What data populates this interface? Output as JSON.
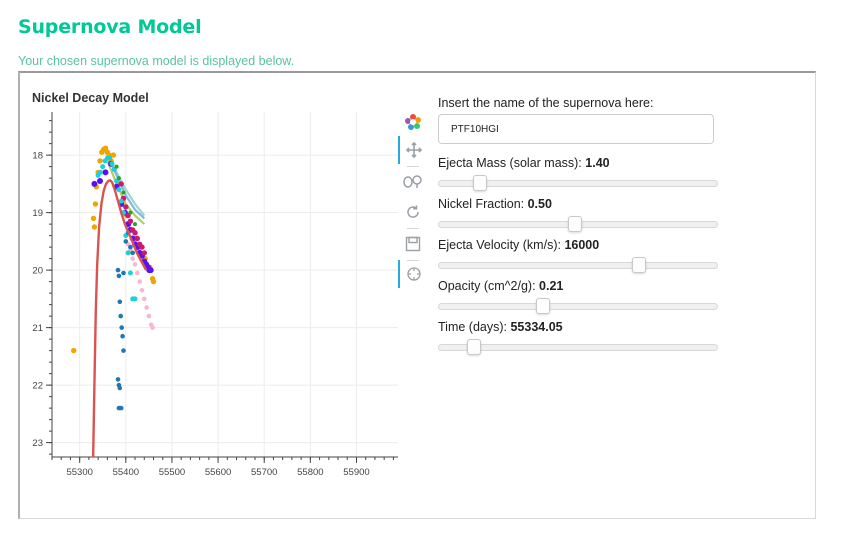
{
  "header": {
    "title": "Supernova Model",
    "subtitle": "Your chosen supernova model is displayed below."
  },
  "toolbar": {
    "tools": [
      {
        "name": "bokeh-logo-icon",
        "active": false
      },
      {
        "name": "pan-icon",
        "active": true
      },
      {
        "name": "box-zoom-icon",
        "active": false
      },
      {
        "name": "reset-icon",
        "active": false
      },
      {
        "name": "save-icon",
        "active": false
      },
      {
        "name": "hover-icon",
        "active": true
      }
    ]
  },
  "controls": {
    "name_label": "Insert the name of the supernova here:",
    "name_value": "PTF10HGI",
    "sliders": [
      {
        "label": "Ejecta Mass (solar mass): ",
        "value_text": "1.40",
        "fraction": 0.13
      },
      {
        "label": "Nickel Fraction: ",
        "value_text": "0.50",
        "fraction": 0.49
      },
      {
        "label": "Ejecta Velocity (km/s): ",
        "value_text": "16000",
        "fraction": 0.73
      },
      {
        "label": "Opacity (cm^2/g): ",
        "value_text": "0.21",
        "fraction": 0.37
      },
      {
        "label": "Time (days): ",
        "value_text": "55334.05",
        "fraction": 0.11
      }
    ]
  },
  "chart_data": {
    "type": "scatter",
    "title": "Nickel Decay Model",
    "xlabel": "",
    "ylabel": "",
    "xlim": [
      55240,
      55990
    ],
    "ylim": [
      23.25,
      17.25
    ],
    "y_inverted": true,
    "grid": true,
    "xticks": [
      55300,
      55400,
      55500,
      55600,
      55700,
      55800,
      55900
    ],
    "yticks": [
      18,
      19,
      20,
      21,
      22,
      23
    ],
    "colors": {
      "orange": "#f0a500",
      "purple": "#5a10f0",
      "magenta": "#cc1a6e",
      "pink": "#f7b6d2",
      "cyan": "#1ecfd6",
      "blue": "#1f77b4",
      "green": "#2ca02c",
      "model": "#d9534f"
    },
    "model_curve": {
      "color": "model",
      "x": [
        55329,
        55332,
        55335,
        55338,
        55342,
        55347,
        55352,
        55357,
        55362,
        55366,
        55370,
        55376,
        55383,
        55390,
        55398,
        55406,
        55414,
        55424,
        55434,
        55444
      ],
      "y": [
        23.3,
        22.0,
        20.7,
        19.9,
        19.25,
        18.85,
        18.62,
        18.5,
        18.45,
        18.44,
        18.47,
        18.6,
        18.8,
        19.0,
        19.2,
        19.35,
        19.5,
        19.7,
        19.85,
        20.0
      ]
    },
    "series": [
      {
        "color": "orange",
        "size": 2.7,
        "points": [
          [
            55287,
            21.4
          ],
          [
            55330,
            19.1
          ],
          [
            55332,
            19.25
          ],
          [
            55334,
            18.85
          ],
          [
            55336,
            18.55
          ],
          [
            55340,
            18.3
          ],
          [
            55344,
            18.1
          ],
          [
            55348,
            17.95
          ],
          [
            55352,
            17.9
          ],
          [
            55356,
            17.88
          ],
          [
            55360,
            17.95
          ],
          [
            55364,
            18.0
          ],
          [
            55368,
            18.1
          ],
          [
            55373,
            18.0
          ],
          [
            55383,
            18.5
          ],
          [
            55392,
            18.8
          ],
          [
            55402,
            19.05
          ],
          [
            55412,
            19.3
          ],
          [
            55422,
            19.45
          ],
          [
            55432,
            19.6
          ],
          [
            55442,
            19.8
          ],
          [
            55452,
            19.95
          ],
          [
            55458,
            20.15
          ],
          [
            55460,
            20.2
          ]
        ]
      },
      {
        "color": "purple",
        "size": 3.0,
        "points": [
          [
            55332,
            18.5
          ],
          [
            55344,
            18.45
          ],
          [
            55356,
            18.3
          ],
          [
            55368,
            18.15
          ],
          [
            55380,
            18.55
          ],
          [
            55390,
            18.85
          ],
          [
            55398,
            19.0
          ],
          [
            55405,
            19.2
          ],
          [
            55410,
            19.3
          ],
          [
            55415,
            19.45
          ],
          [
            55420,
            19.55
          ],
          [
            55425,
            19.6
          ],
          [
            55430,
            19.7
          ],
          [
            55435,
            19.75
          ],
          [
            55440,
            19.85
          ],
          [
            55444,
            19.9
          ],
          [
            55448,
            19.95
          ],
          [
            55451,
            20.0
          ],
          [
            55454,
            20.0
          ]
        ]
      },
      {
        "color": "magenta",
        "size": 2.7,
        "points": [
          [
            55390,
            18.5
          ],
          [
            55395,
            18.75
          ],
          [
            55400,
            18.9
          ],
          [
            55405,
            19.05
          ],
          [
            55410,
            19.15
          ],
          [
            55415,
            19.3
          ],
          [
            55420,
            19.35
          ],
          [
            55425,
            19.45
          ],
          [
            55430,
            19.55
          ],
          [
            55435,
            19.6
          ],
          [
            55440,
            19.7
          ]
        ]
      },
      {
        "color": "pink",
        "size": 2.3,
        "points": [
          [
            55400,
            19.4
          ],
          [
            55405,
            19.55
          ],
          [
            55410,
            19.65
          ],
          [
            55415,
            19.8
          ],
          [
            55420,
            19.9
          ],
          [
            55425,
            20.05
          ],
          [
            55430,
            20.2
          ],
          [
            55435,
            20.35
          ],
          [
            55440,
            20.5
          ],
          [
            55445,
            20.65
          ],
          [
            55450,
            20.8
          ],
          [
            55455,
            20.95
          ],
          [
            55458,
            21.0
          ]
        ]
      },
      {
        "color": "cyan",
        "size": 2.5,
        "points": [
          [
            55340,
            18.35
          ],
          [
            55345,
            18.3
          ],
          [
            55350,
            18.2
          ],
          [
            55355,
            18.1
          ],
          [
            55360,
            18.05
          ],
          [
            55365,
            18.05
          ],
          [
            55370,
            18.15
          ],
          [
            55375,
            18.25
          ],
          [
            55380,
            18.45
          ],
          [
            55385,
            18.6
          ],
          [
            55390,
            18.8
          ],
          [
            55395,
            19.0
          ],
          [
            55400,
            19.4
          ],
          [
            55405,
            19.7
          ],
          [
            55410,
            20.05
          ],
          [
            55415,
            20.5
          ],
          [
            55420,
            20.5
          ]
        ]
      },
      {
        "color": "blue",
        "size": 2.3,
        "points": [
          [
            55383,
            20.0
          ],
          [
            55385,
            20.1
          ],
          [
            55387,
            20.55
          ],
          [
            55389,
            20.8
          ],
          [
            55391,
            21.0
          ],
          [
            55393,
            21.15
          ],
          [
            55395,
            21.4
          ],
          [
            55383,
            21.9
          ],
          [
            55385,
            22.0
          ],
          [
            55387,
            22.05
          ],
          [
            55385,
            22.4
          ],
          [
            55390,
            22.4
          ],
          [
            55395,
            20.05
          ],
          [
            55400,
            19.5
          ],
          [
            55405,
            19.35
          ],
          [
            55410,
            19.6
          ],
          [
            55415,
            19.7
          ]
        ]
      },
      {
        "color": "green",
        "size": 2.0,
        "points": [
          [
            55380,
            18.2
          ],
          [
            55385,
            18.4
          ],
          [
            55395,
            18.65
          ],
          [
            55410,
            19.0
          ],
          [
            55420,
            19.2
          ]
        ]
      }
    ],
    "band_lines": [
      {
        "color": "#9fd6cf",
        "x": [
          55360,
          55380,
          55400,
          55420,
          55440
        ],
        "y": [
          17.95,
          18.3,
          18.6,
          18.85,
          19.05
        ]
      },
      {
        "color": "#7fb8e0",
        "x": [
          55360,
          55380,
          55400,
          55420,
          55440
        ],
        "y": [
          18.0,
          18.35,
          18.7,
          18.95,
          19.1
        ]
      },
      {
        "color": "#b0d060",
        "x": [
          55360,
          55380,
          55400,
          55420,
          55440
        ],
        "y": [
          18.1,
          18.5,
          18.85,
          19.05,
          19.2
        ]
      }
    ]
  }
}
